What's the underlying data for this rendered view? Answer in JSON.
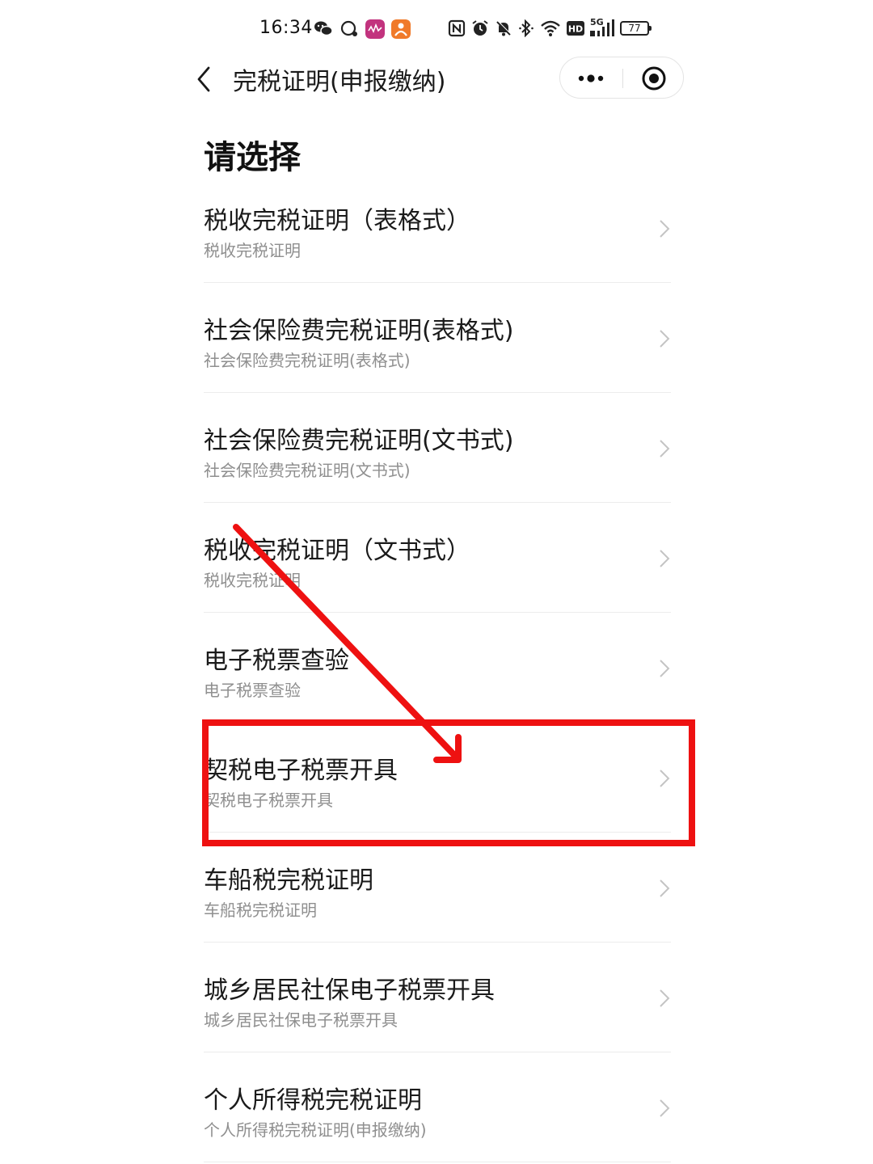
{
  "status_bar": {
    "time": "16:34",
    "battery": "77",
    "network": "5G",
    "icons": [
      "wechat-icon",
      "chat-bubble-icon",
      "music-app-icon",
      "orange-app-icon",
      "nfc-icon",
      "alarm-icon",
      "mute-icon",
      "bluetooth-icon",
      "wifi-icon",
      "hd-icon",
      "signal-icon",
      "battery-icon"
    ]
  },
  "nav": {
    "title": "完税证明(申报缴纳)",
    "back_icon": "chevron-left-icon",
    "more_icon": "more-dots-icon",
    "close_icon": "target-close-icon"
  },
  "page": {
    "heading": "请选择"
  },
  "options": [
    {
      "title": "税收完税证明（表格式）",
      "subtitle": "税收完税证明"
    },
    {
      "title": "社会保险费完税证明(表格式)",
      "subtitle": "社会保险费完税证明(表格式)"
    },
    {
      "title": "社会保险费完税证明(文书式)",
      "subtitle": "社会保险费完税证明(文书式)"
    },
    {
      "title": "税收完税证明（文书式）",
      "subtitle": "税收完税证明"
    },
    {
      "title": "电子税票查验",
      "subtitle": "电子税票查验"
    },
    {
      "title": "契税电子税票开具",
      "subtitle": "契税电子税票开具"
    },
    {
      "title": "车船税完税证明",
      "subtitle": "车船税完税证明"
    },
    {
      "title": "城乡居民社保电子税票开具",
      "subtitle": "城乡居民社保电子税票开具"
    },
    {
      "title": "个人所得税完税证明",
      "subtitle": "个人所得税完税证明(申报缴纳)"
    }
  ],
  "annotation": {
    "color": "#ee1111",
    "highlighted_option": "契税电子税票开具"
  }
}
